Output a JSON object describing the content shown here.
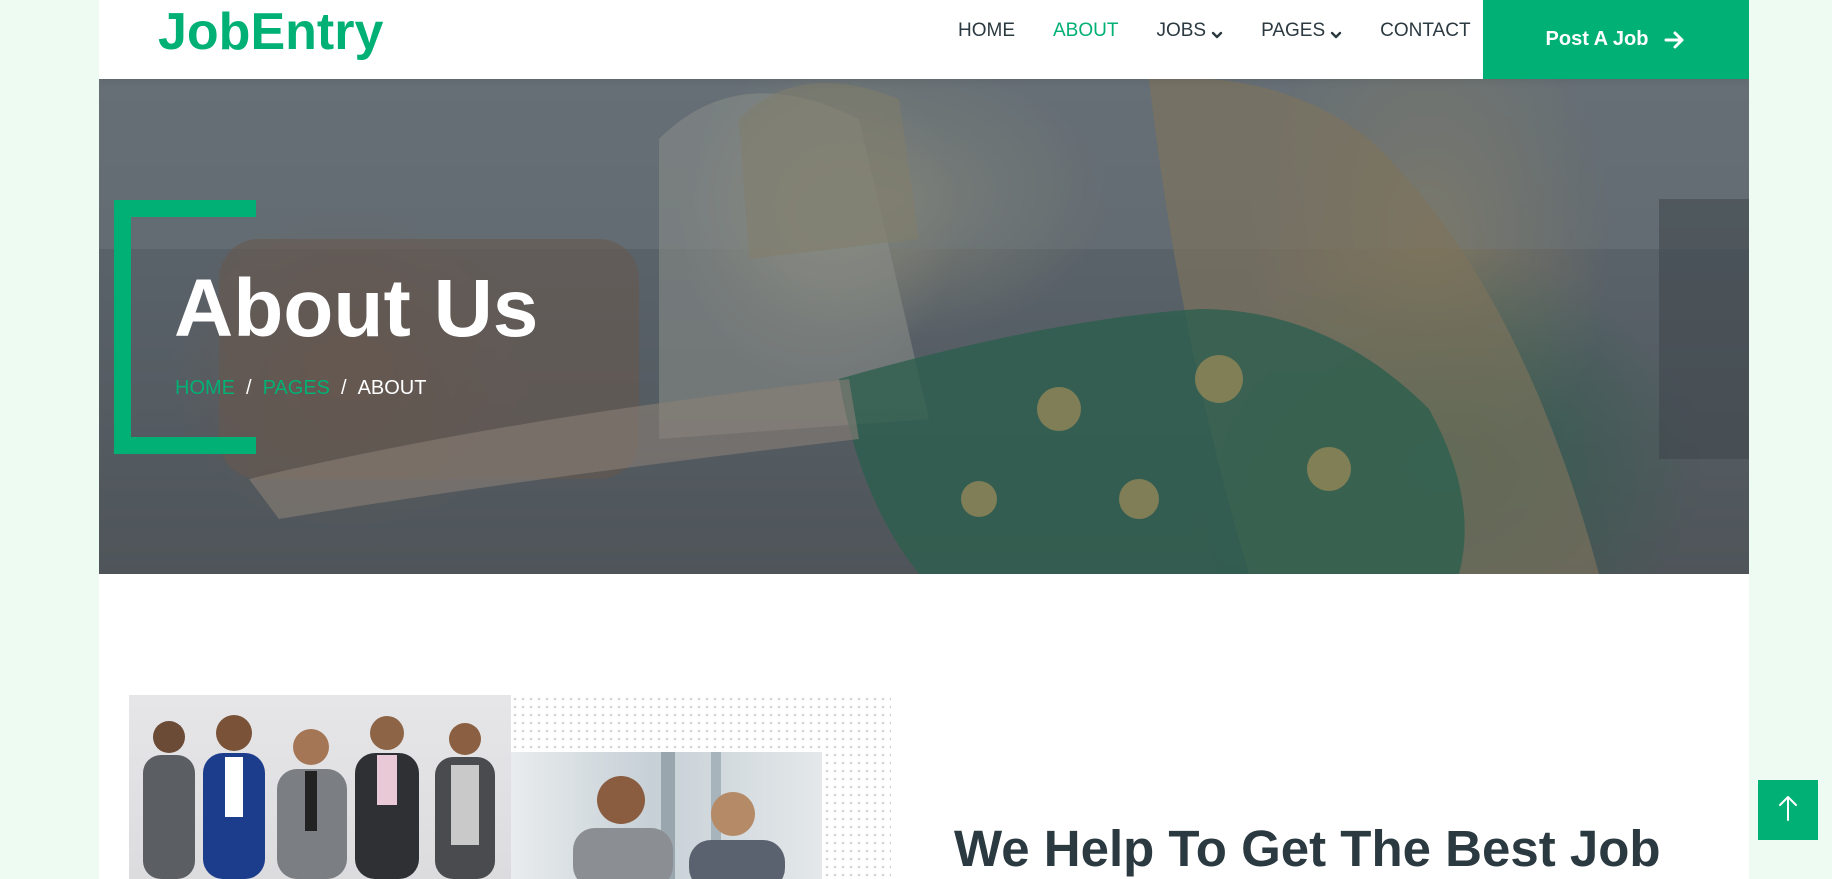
{
  "brand": {
    "name": "JobEntry"
  },
  "nav": {
    "items": [
      {
        "label": "HOME",
        "active": false,
        "dropdown": false
      },
      {
        "label": "ABOUT",
        "active": true,
        "dropdown": false
      },
      {
        "label": "JOBS",
        "active": false,
        "dropdown": true
      },
      {
        "label": "PAGES",
        "active": false,
        "dropdown": true
      },
      {
        "label": "CONTACT",
        "active": false,
        "dropdown": false
      }
    ],
    "cta_label": "Post A Job",
    "cta_icon": "arrow-right-icon"
  },
  "hero": {
    "title": "About Us",
    "breadcrumb": [
      {
        "label": "HOME"
      },
      {
        "label": "PAGES"
      }
    ],
    "breadcrumb_separator": "/",
    "current": "ABOUT"
  },
  "about": {
    "heading": "We Help To Get The Best Job"
  },
  "back_to_top": {
    "icon": "arrow-up-icon"
  },
  "colors": {
    "primary": "#00b074",
    "dark": "#2b3940",
    "page_bg": "#eefbf3"
  }
}
